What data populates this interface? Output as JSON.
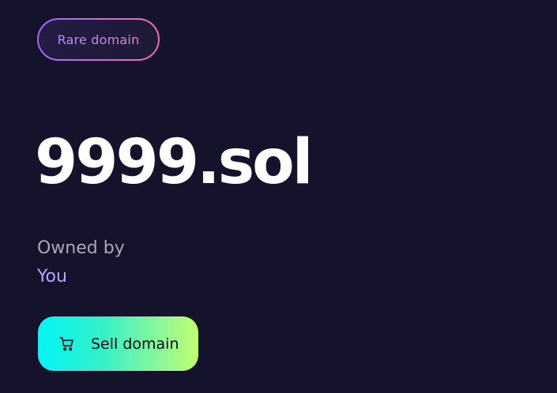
{
  "badge": {
    "label": "Rare domain"
  },
  "domain": {
    "name": "9999.sol"
  },
  "owner": {
    "label": "Owned by",
    "value": "You"
  },
  "actions": {
    "sell_label": "Sell domain",
    "sell_icon": "cart-icon"
  },
  "colors": {
    "background": "#14132b",
    "badge_gradient": [
      "#9b6cf2",
      "#f06aa6"
    ],
    "owner_accent": "#b6a6ff",
    "button_gradient": [
      "#03f5f5",
      "#c2fd6f"
    ]
  }
}
